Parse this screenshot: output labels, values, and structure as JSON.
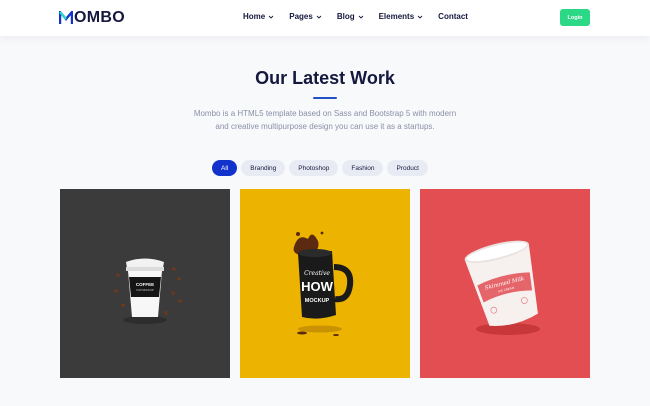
{
  "brand": {
    "name": "MOMBO",
    "logo_letter": "M",
    "logo_rest": "OMBO",
    "accent": "#1133cc"
  },
  "nav": {
    "items": [
      {
        "label": "Home",
        "dropdown": true
      },
      {
        "label": "Pages",
        "dropdown": true
      },
      {
        "label": "Blog",
        "dropdown": true
      },
      {
        "label": "Elements",
        "dropdown": true
      },
      {
        "label": "Contact",
        "dropdown": false
      }
    ],
    "login_label": "Login",
    "login_color": "#2bd885"
  },
  "section": {
    "title": "Our Latest Work",
    "subtitle": "Mombo is a HTML5 template based on Sass and Bootstrap 5 with modern and creative multipurpose design you can use it as a startups."
  },
  "filters": [
    {
      "label": "All",
      "active": true
    },
    {
      "label": "Branding",
      "active": false
    },
    {
      "label": "Photoshop",
      "active": false
    },
    {
      "label": "Fashion",
      "active": false
    },
    {
      "label": "Product",
      "active": false
    }
  ],
  "portfolio": [
    {
      "image": "coffee-cup-mockup",
      "background": "#3b3b3b",
      "cup_text_1": "COFFEE",
      "cup_text_2": "CUP MOCKUP"
    },
    {
      "image": "mug-mockup",
      "background": "#ecb300",
      "mug_text_1": "Creative",
      "mug_text_2": "HOW",
      "mug_text_3": "MOCKUP"
    },
    {
      "image": "paper-tub-mockup",
      "background": "#e24e52",
      "tub_text_1": "Skimmed Milk",
      "tub_text_2": "ICE CREAM"
    }
  ]
}
